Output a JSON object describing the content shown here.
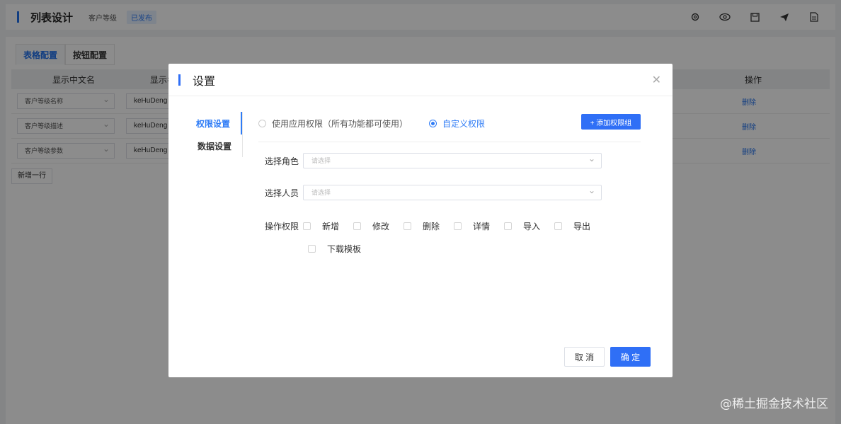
{
  "header": {
    "title": "列表设计",
    "subtitle": "客户等级",
    "status_badge": "已发布",
    "icons": [
      "gear-icon",
      "eye-icon",
      "save-icon",
      "send-icon",
      "document-icon"
    ]
  },
  "tabs": [
    {
      "label": "表格配置",
      "active": true
    },
    {
      "label": "按钮配置",
      "active": false
    }
  ],
  "table": {
    "headers": [
      "显示中文名",
      "显示名",
      "操作"
    ],
    "rows": [
      {
        "name": "客户等级名称",
        "field": "keHuDeng",
        "action": "删除"
      },
      {
        "name": "客户等级描述",
        "field": "keHuDeng",
        "action": "删除"
      },
      {
        "name": "客户等级参数",
        "field": "keHuDeng",
        "action": "删除"
      }
    ],
    "add_row_label": "新增一行"
  },
  "modal": {
    "title": "设置",
    "side_items": [
      {
        "label": "权限设置",
        "active": true
      },
      {
        "label": "数据设置",
        "active": false
      }
    ],
    "radios": [
      {
        "label": "使用应用权限（所有功能都可使用）",
        "checked": false
      },
      {
        "label": "自定义权限",
        "checked": true
      }
    ],
    "add_group_label": "+ 添加权限组",
    "role_label": "选择角色",
    "role_placeholder": "请选择",
    "person_label": "选择人员",
    "person_placeholder": "请选择",
    "perm_label": "操作权限",
    "permissions": [
      "新增",
      "修改",
      "删除",
      "详情",
      "导入",
      "导出",
      "下载模板"
    ],
    "cancel_label": "取 消",
    "ok_label": "确 定"
  },
  "watermark": "@稀土掘金技术社区",
  "colors": {
    "accent": "#2f6ff6",
    "active_text": "#2f7cf6",
    "mask": "rgba(0,0,0,0.45)"
  }
}
